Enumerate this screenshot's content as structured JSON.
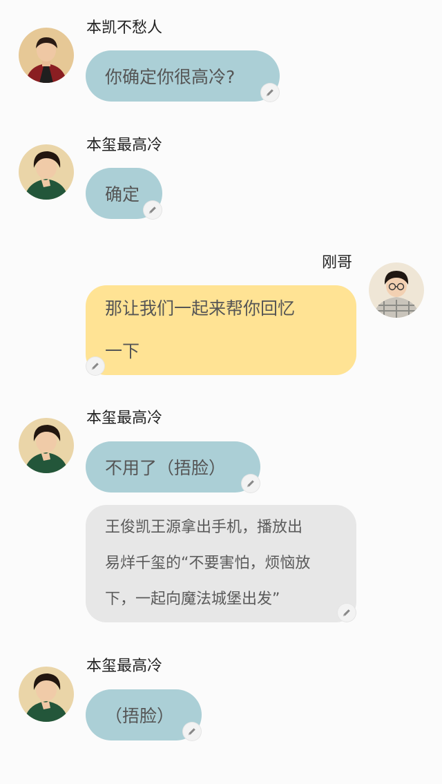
{
  "speakers": {
    "kai": "本凯不愁人",
    "qian": "本玺最高冷",
    "gang": "刚哥"
  },
  "messages": [
    {
      "speaker": "本凯不愁人",
      "text": "你确定你很高冷?"
    },
    {
      "speaker": "本玺最高冷",
      "text": "确定"
    },
    {
      "speaker": "刚哥",
      "text": "那让我们一起来帮你回忆\n一下"
    },
    {
      "speaker": "本玺最高冷",
      "text": "不用了（捂脸）"
    },
    {
      "narration": "王俊凯王源拿出手机，播放出\n易烊千玺的“不要害怕，烦恼放\n下，一起向魔法城堡出发”"
    },
    {
      "speaker": "本玺最高冷",
      "text": "（捂脸）"
    }
  ],
  "colors": {
    "blue_bubble": "#abcfd6",
    "yellow_bubble": "#ffe394",
    "grey_bubble": "#e7e7e7",
    "background": "#fbfbfb"
  },
  "icons": [
    "pencil-icon",
    "avatar-kai",
    "avatar-qian",
    "avatar-gang"
  ]
}
